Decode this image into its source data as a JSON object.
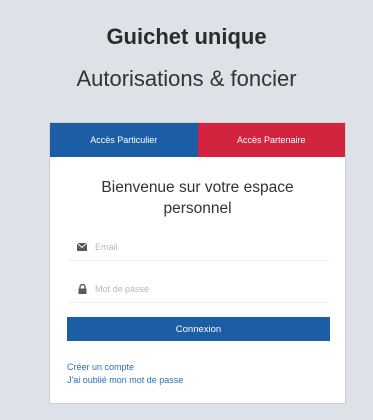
{
  "header": {
    "title": "Guichet unique",
    "subtitle": "Autorisations & foncier"
  },
  "tabs": [
    {
      "label": "Accès Particulier",
      "color": "#1b5ea6"
    },
    {
      "label": "Accès Partenaire",
      "color": "#d2233f"
    }
  ],
  "welcome": "Bienvenue sur votre espace personnel",
  "form": {
    "email_placeholder": "Email",
    "password_placeholder": "Mot de passe",
    "submit_label": "Connexion"
  },
  "links": {
    "create_account": "Créer un compte",
    "forgot_password": "J'ai oublié mon mot de passe"
  },
  "icons": {
    "email": "envelope-icon",
    "password": "lock-icon"
  }
}
